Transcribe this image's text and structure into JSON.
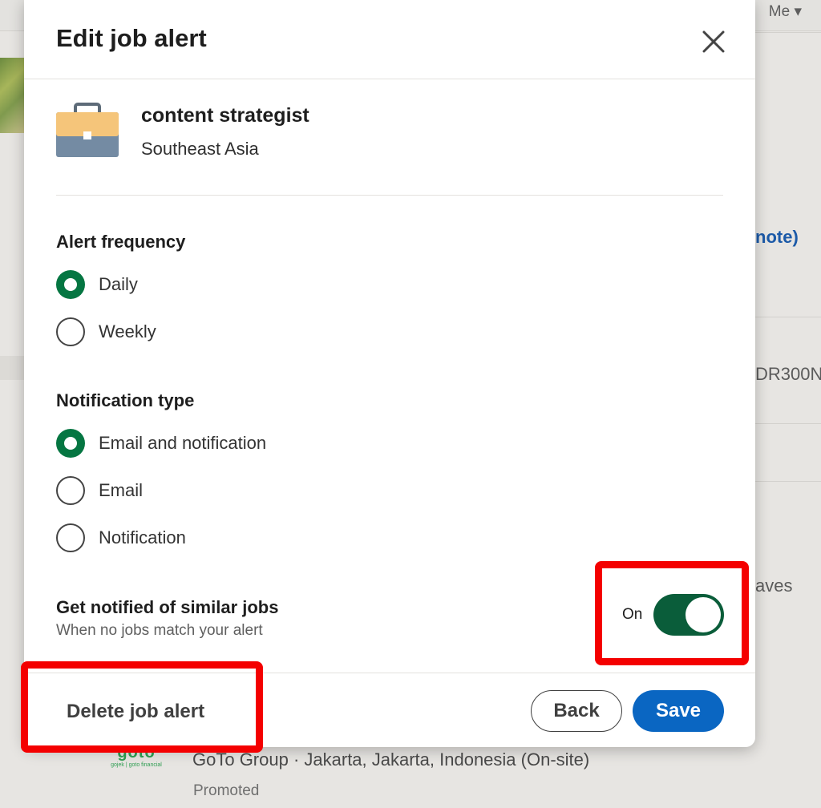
{
  "background": {
    "topbar_me": "Me",
    "right_items": [
      "note)",
      "DR300N",
      "aves"
    ],
    "job": {
      "company_logo_text": "goto",
      "company_logo_subtext": "gojek | goto financial",
      "line": "GoTo Group · Jakarta, Jakarta, Indonesia (On-site)",
      "status": "Promoted"
    }
  },
  "modal": {
    "title": "Edit job alert",
    "close_icon": "close-icon",
    "job": {
      "icon": "briefcase-icon",
      "title": "content strategist",
      "location": "Southeast Asia"
    },
    "alert_frequency": {
      "label": "Alert frequency",
      "options": [
        {
          "label": "Daily",
          "checked": true
        },
        {
          "label": "Weekly",
          "checked": false
        }
      ]
    },
    "notification_type": {
      "label": "Notification type",
      "options": [
        {
          "label": "Email and notification",
          "checked": true
        },
        {
          "label": "Email",
          "checked": false
        },
        {
          "label": "Notification",
          "checked": false
        }
      ]
    },
    "similar_jobs": {
      "title": "Get notified of similar jobs",
      "subtitle": "When no jobs match your alert",
      "toggle_label": "On",
      "enabled": true
    },
    "footer": {
      "delete_label": "Delete job alert",
      "back_label": "Back",
      "save_label": "Save"
    }
  },
  "colors": {
    "accent_green": "#057642",
    "toggle_green": "#0a5d3a",
    "primary_blue": "#0a66c2",
    "highlight_red": "#f40000"
  }
}
